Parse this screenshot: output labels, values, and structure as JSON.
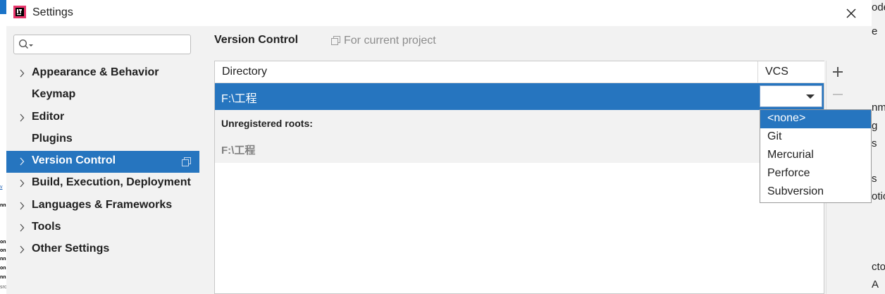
{
  "window": {
    "title": "Settings"
  },
  "sidebar": {
    "search_placeholder": "",
    "items": [
      {
        "label": "Appearance & Behavior",
        "expandable": true
      },
      {
        "label": "Keymap",
        "expandable": false
      },
      {
        "label": "Editor",
        "expandable": true
      },
      {
        "label": "Plugins",
        "expandable": false
      },
      {
        "label": "Version Control",
        "expandable": true,
        "selected": true
      },
      {
        "label": "Build, Execution, Deployment",
        "expandable": true
      },
      {
        "label": "Languages & Frameworks",
        "expandable": true
      },
      {
        "label": "Tools",
        "expandable": true
      },
      {
        "label": "Other Settings",
        "expandable": true
      }
    ]
  },
  "panel": {
    "title": "Version Control",
    "scope_label": "For current project",
    "table": {
      "columns": [
        "Directory",
        "VCS"
      ],
      "rows": [
        {
          "directory": "F:\\工程",
          "vcs": ""
        }
      ],
      "unregistered_label": "Unregistered roots:",
      "unregistered_roots": [
        "F:\\工程"
      ]
    }
  },
  "dropdown": {
    "options": [
      "<none>",
      "Git",
      "Mercurial",
      "Perforce",
      "Subversion"
    ],
    "highlighted": "<none>"
  },
  "colors": {
    "accent": "#2675bf",
    "background": "#f2f2f2"
  },
  "background_fragments": {
    "right": [
      "ode",
      "e",
      "nm",
      "g",
      "s",
      "s",
      "otio",
      "cto",
      "A"
    ],
    "left": [
      "v",
      "nn",
      "on",
      "on",
      "nn",
      "on",
      "nn",
      "src"
    ]
  }
}
